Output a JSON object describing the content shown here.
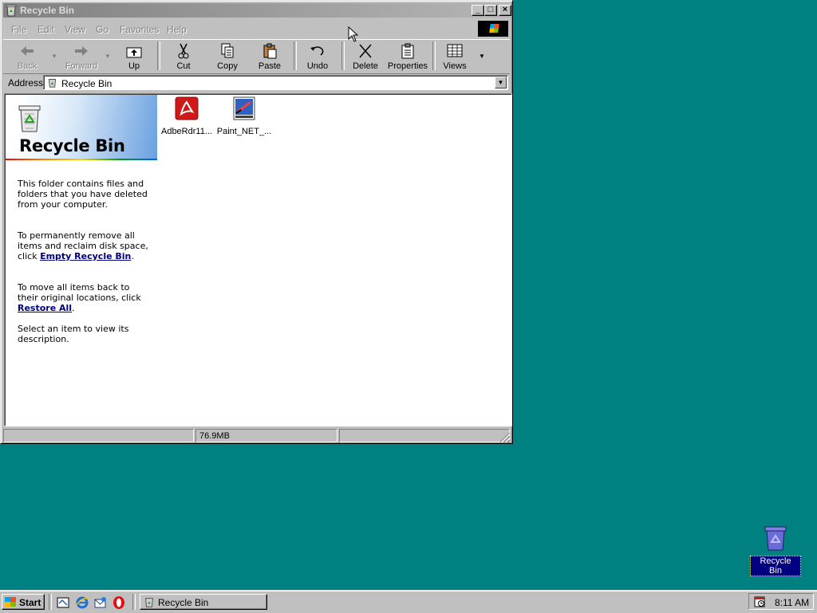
{
  "window": {
    "title": "Recycle Bin",
    "caption_buttons": {
      "minimize": "_",
      "maximize": "□",
      "close": "×"
    }
  },
  "menu": [
    "File",
    "Edit",
    "View",
    "Go",
    "Favorites",
    "Help"
  ],
  "toolbar": {
    "back": "Back",
    "forward": "Forward",
    "up": "Up",
    "cut": "Cut",
    "copy": "Copy",
    "paste": "Paste",
    "undo": "Undo",
    "delete": "Delete",
    "properties": "Properties",
    "views": "Views"
  },
  "address": {
    "label": "Address",
    "value": "Recycle Bin"
  },
  "info_panel": {
    "title": "Recycle Bin",
    "p1": "This folder contains files and folders that you have deleted from your computer.",
    "p2_text": "To permanently remove all items and reclaim disk space, click",
    "p2_link": "Empty Recycle Bin",
    "p3_text": "To move all items back to their original locations, click",
    "p3_link": "Restore All",
    "p4": "Select an item to view its description."
  },
  "files": [
    {
      "name": "AdbeRdr11...",
      "icon": "pdf-installer-icon"
    },
    {
      "name": "Paint_NET_...",
      "icon": "paintnet-installer-icon"
    }
  ],
  "statusbar": {
    "size": "76.9MB"
  },
  "desktop": {
    "icon_label": "Recycle Bin"
  },
  "taskbar": {
    "start": "Start",
    "task_button": "Recycle Bin",
    "clock": "8:11 AM"
  },
  "colors": {
    "desktop": "#008080",
    "face": "#c0c0c0",
    "link": "#000080",
    "selection": "#000080"
  }
}
